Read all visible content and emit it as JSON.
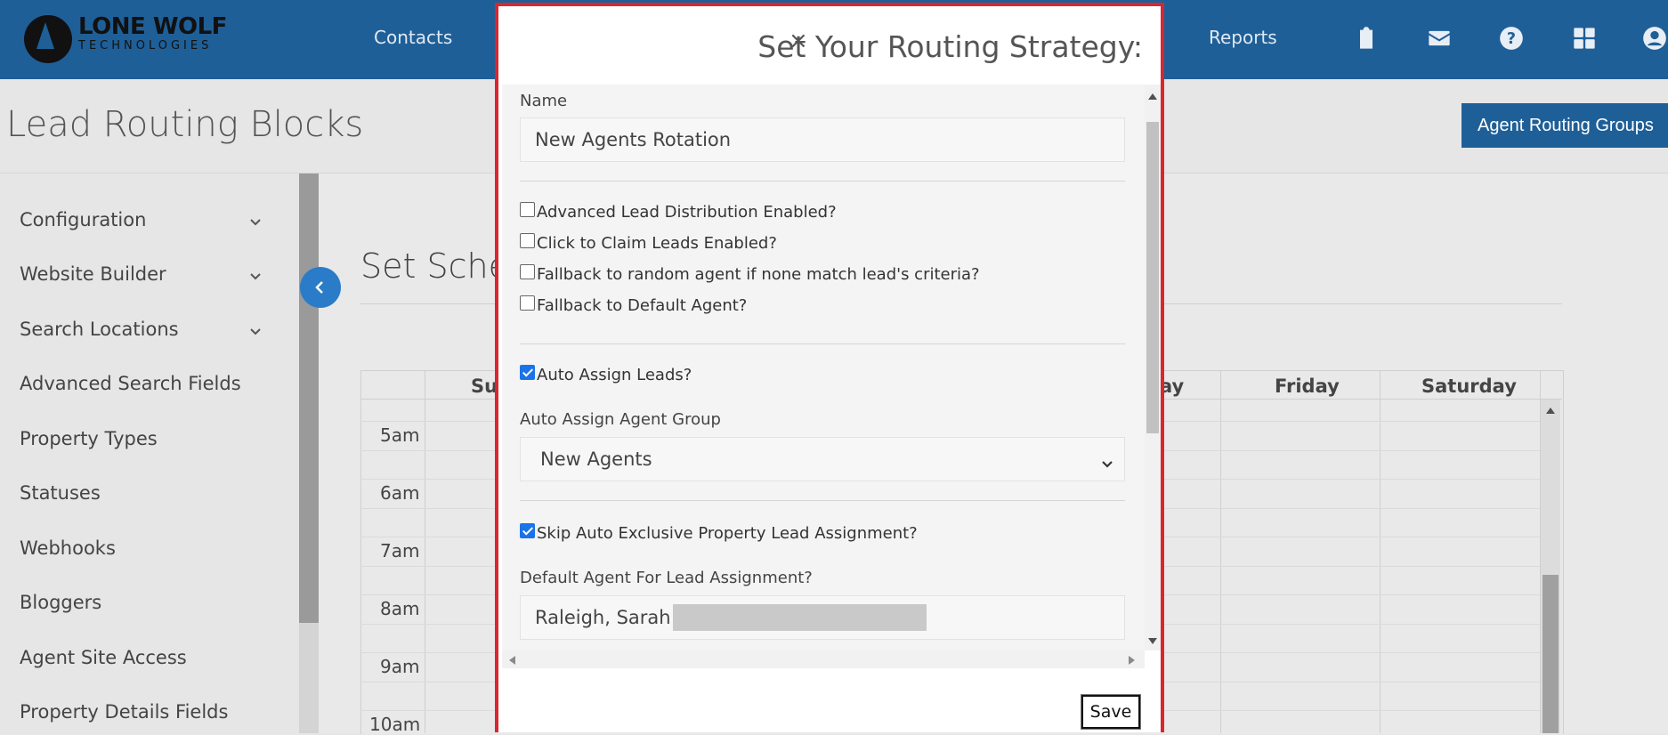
{
  "topbar": {
    "logo_line1": "LONE WOLF",
    "logo_line2": "TECHNOLOGIES",
    "nav": [
      "Contacts",
      "Reports"
    ],
    "icons": [
      "clipboard-check-icon",
      "envelope-icon",
      "help-icon",
      "apps-grid-icon",
      "user-icon"
    ]
  },
  "page": {
    "title": "Lead Routing Blocks",
    "agent_routing_groups_button": "Agent Routing Groups"
  },
  "sidebar": {
    "items": [
      {
        "label": "Configuration",
        "expandable": true
      },
      {
        "label": "Website Builder",
        "expandable": true
      },
      {
        "label": "Search Locations",
        "expandable": true
      },
      {
        "label": "Advanced Search Fields",
        "expandable": false
      },
      {
        "label": "Property Types",
        "expandable": false
      },
      {
        "label": "Statuses",
        "expandable": false
      },
      {
        "label": "Webhooks",
        "expandable": false
      },
      {
        "label": "Bloggers",
        "expandable": false
      },
      {
        "label": "Agent Site Access",
        "expandable": false
      },
      {
        "label": "Property Details Fields",
        "expandable": false
      }
    ]
  },
  "schedule": {
    "title": "Set Sched",
    "days": [
      "Su",
      "ay",
      "Friday",
      "Saturday"
    ],
    "times": [
      "5am",
      "6am",
      "7am",
      "8am",
      "9am",
      "10am"
    ]
  },
  "modal": {
    "title": "Set Your Routing Strategy:",
    "close": "×",
    "name_label": "Name",
    "name_value": "New Agents Rotation",
    "checkboxes_group1": [
      {
        "label": "Advanced Lead Distribution Enabled?",
        "checked": false
      },
      {
        "label": "Click to Claim Leads Enabled?",
        "checked": false
      },
      {
        "label": "Fallback to random agent if none match lead's criteria?",
        "checked": false
      },
      {
        "label": "Fallback to Default Agent?",
        "checked": false
      }
    ],
    "auto_assign": {
      "label": "Auto Assign Leads?",
      "checked": true
    },
    "agent_group_label": "Auto Assign Agent Group",
    "agent_group_value": "New Agents",
    "skip_exclusive": {
      "label": "Skip Auto Exclusive Property Lead Assignment?",
      "checked": true
    },
    "default_agent_label": "Default Agent For Lead Assignment?",
    "default_agent_value": "Raleigh, Sarah",
    "save_label": "Save"
  },
  "colors": {
    "topbar": "#1f5f98",
    "accent": "#2a7cc9",
    "modal_border": "#d9262f"
  }
}
